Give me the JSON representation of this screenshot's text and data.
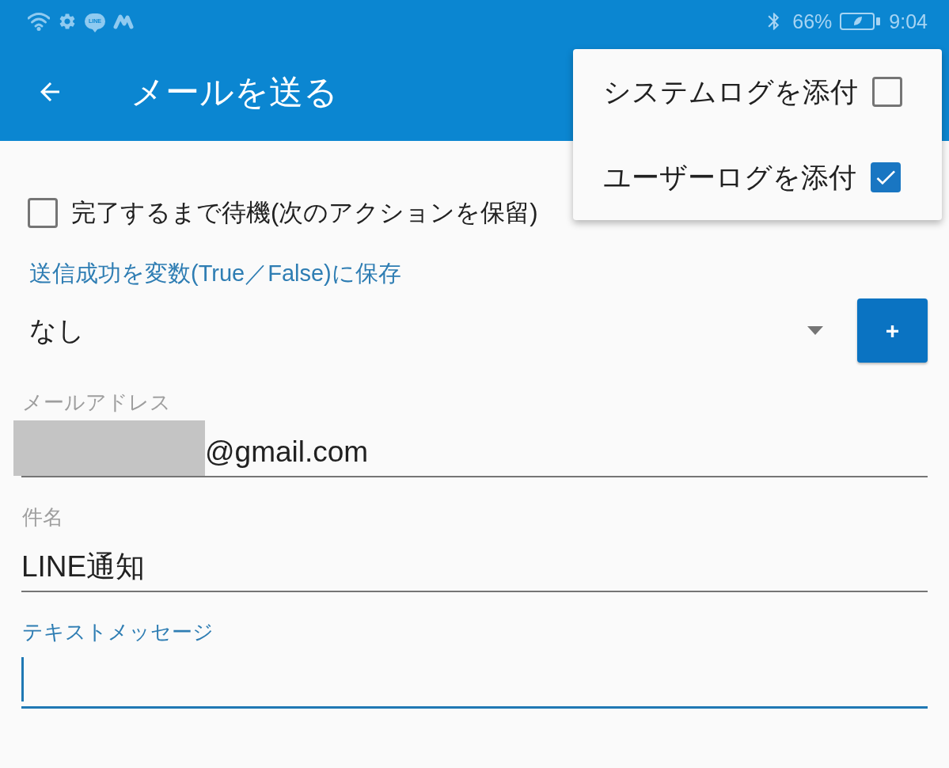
{
  "status_bar": {
    "notification_badge": "LINE",
    "battery_percent": "66%",
    "time": "9:04"
  },
  "app_bar": {
    "title": "メールを送る"
  },
  "overflow_menu": {
    "items": [
      {
        "label": "システムログを添付",
        "checked": false
      },
      {
        "label": "ユーザーログを添付",
        "checked": true
      }
    ]
  },
  "wait_option": {
    "label": "完了するまで待機(次のアクションを保留)",
    "checked": false
  },
  "result_variable": {
    "label": "送信成功を変数(True／False)に保存",
    "value": "なし",
    "add_button": "+"
  },
  "fields": [
    {
      "label": "メールアドレス",
      "value": "@gmail.com",
      "redacted": true,
      "focused": false
    },
    {
      "label": "件名",
      "value": "LINE通知",
      "redacted": false,
      "focused": false
    },
    {
      "label": "テキストメッセージ",
      "redacted": false,
      "focused": true
    }
  ]
}
